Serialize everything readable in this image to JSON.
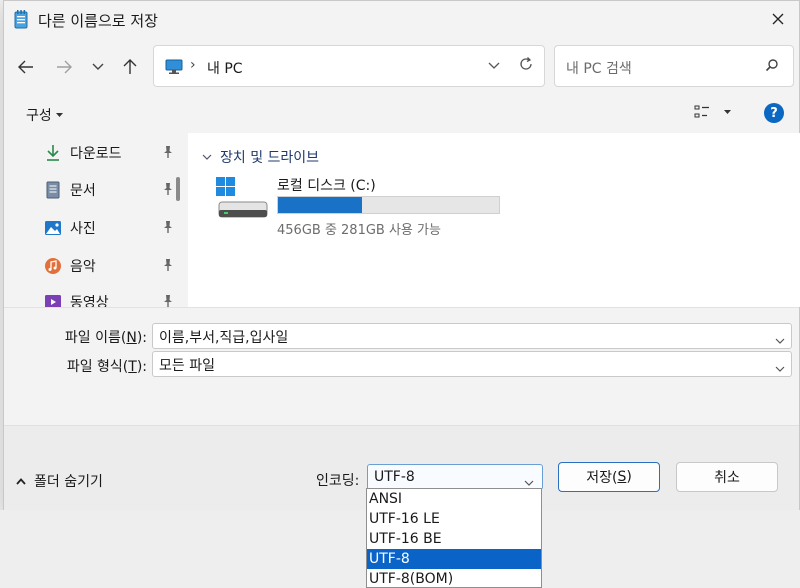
{
  "window": {
    "title": "다른 이름으로 저장"
  },
  "nav": {
    "path": "내 PC",
    "path_separator": "›",
    "search_placeholder": "내 PC 검색"
  },
  "commandbar": {
    "organize_label": "구성",
    "help_label": "?"
  },
  "sidebar": {
    "items": [
      {
        "label": "다운로드",
        "icon": "download-icon"
      },
      {
        "label": "문서",
        "icon": "document-icon"
      },
      {
        "label": "사진",
        "icon": "picture-icon"
      },
      {
        "label": "음악",
        "icon": "music-icon"
      },
      {
        "label": "동영상",
        "icon": "video-icon"
      }
    ]
  },
  "content": {
    "group_header": "장치 및 드라이브",
    "drives": [
      {
        "name": "로컬 디스크 (C:)",
        "free_text": "456GB 중 281GB 사용 가능",
        "used_fraction": 0.38,
        "color": "#1a72c7"
      }
    ]
  },
  "fields": {
    "filename_label_pre": "파일 이름(",
    "filename_label_key": "N",
    "filename_label_post": "):",
    "filename_value": "이름,부서,직급,입사일",
    "filetype_label_pre": "파일 형식(",
    "filetype_label_key": "T",
    "filetype_label_post": "):",
    "filetype_value": "모든 파일"
  },
  "footer": {
    "hide_folders_label": "폴더 숨기기",
    "encoding_label": "인코딩:",
    "encoding_value": "UTF-8",
    "save_label_pre": "저장(",
    "save_label_key": "S",
    "save_label_post": ")",
    "cancel_label": "취소"
  },
  "encoding_options": [
    {
      "label": "ANSI",
      "selected": false
    },
    {
      "label": "UTF-16 LE",
      "selected": false
    },
    {
      "label": "UTF-16 BE",
      "selected": false
    },
    {
      "label": "UTF-8",
      "selected": true
    },
    {
      "label": "UTF-8(BOM)",
      "selected": false
    }
  ],
  "colors": {
    "accent": "#0a63c6",
    "drive_bar": "#1a72c7"
  }
}
